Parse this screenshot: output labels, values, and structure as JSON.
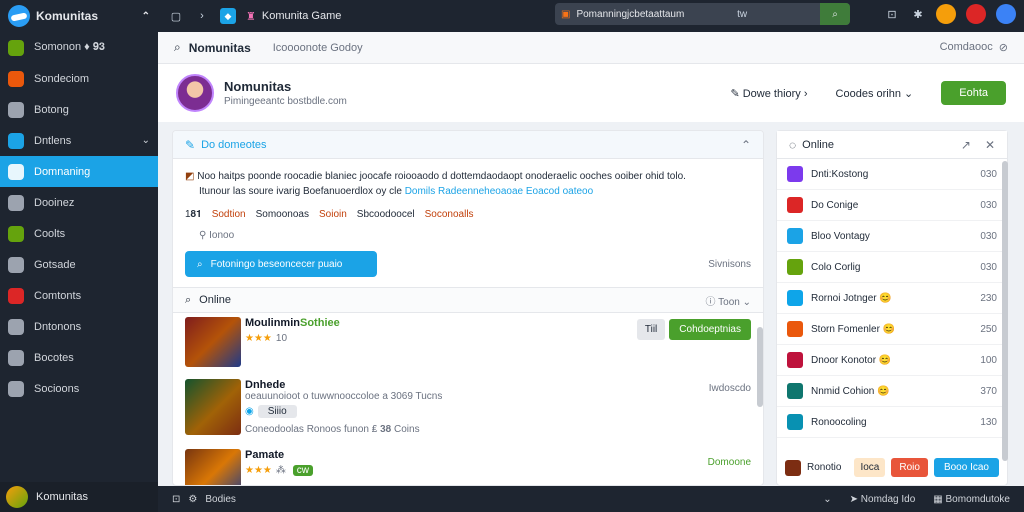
{
  "app": {
    "title": "Komunitas",
    "window_title": "Komunita Game"
  },
  "search": {
    "text": "Pomanningjcbetaattaum",
    "shortcut": "tw"
  },
  "sidebar": {
    "items": [
      {
        "label": "Somonon ♦ 𝟗𝟑",
        "icon": "community-icon"
      },
      {
        "label": "Sondeciom",
        "icon": "orb-icon"
      },
      {
        "label": "Botong",
        "icon": "person-icon"
      },
      {
        "label": "Dntlens",
        "icon": "game-icon",
        "tail": "⌄"
      },
      {
        "label": "Domnaning",
        "icon": "chat-icon",
        "active": true
      },
      {
        "label": "Dooinez",
        "icon": "folder-icon"
      },
      {
        "label": "Coolts",
        "icon": "map-icon"
      },
      {
        "label": "Gotsade",
        "icon": "heart-icon"
      },
      {
        "label": "Comtonts",
        "icon": "grid-icon"
      },
      {
        "label": "Dntonons",
        "icon": "briefcase-icon"
      },
      {
        "label": "Bocotes",
        "icon": "box-icon"
      },
      {
        "label": "Socioons",
        "icon": "list-icon"
      }
    ],
    "footer": "Komunitas"
  },
  "subbar": {
    "title": "Nomunitas",
    "crumb": "Icoooonote Godoy",
    "right": "Comdaooc"
  },
  "profile": {
    "name": "Nomunitas",
    "subtitle": "Pimingeeantc bostbdle.com",
    "action1": "Dowe thiory",
    "action2": "Coodes orihn",
    "button": "Eohta"
  },
  "feed": {
    "header": "Do domeotes",
    "post_text": "Noo haitps poonde roocadie blaniec joocafe roiooaodo d dottemdaodaopt onoderaelic ooches ooiber ohid tolo.",
    "post_text2": "Itunour las soure ivarig Boefanuoerdlox oy cle",
    "post_highlight": "Domils Radeenneheoaoae Eoacod oateoo",
    "tags": [
      "1𝟖𝟏",
      "Sodtion",
      "Somoonoas",
      "Soioin",
      "Sbcoodoocel",
      "Soconoalls"
    ],
    "meta": "Ionoo",
    "button": "Fotoningo beseoncecer puaio",
    "button_right": "Sivnisons",
    "section": "Online",
    "section_right": "Toon",
    "rows": [
      {
        "title": "Moulinmin",
        "title_hl": "Sothiee",
        "rating": "★★★",
        "count": "10",
        "btn1": "Tiil",
        "btn2": "Cohdoeptnias"
      },
      {
        "title": "Dnhede",
        "desc": "oeauunoioot o tuwwnooccoloe a 3069 Tucns",
        "right": "Iwdoscdo",
        "pill": "Siiio",
        "foot": "Coneodoolas Ronoos funon ₤ 𝟑𝟖 Coins"
      },
      {
        "title": "Pamate",
        "rating": "★★★",
        "count": "⁂",
        "pill": "cw",
        "right": "Domoone"
      }
    ]
  },
  "online": {
    "header": "Online",
    "items": [
      {
        "name": "Dnti:Kostong",
        "time": "030",
        "color": "#7c3aed"
      },
      {
        "name": "Do Conige",
        "time": "030",
        "color": "#dc2626"
      },
      {
        "name": "Bloo Vontagy",
        "time": "030",
        "color": "#1ba3e6"
      },
      {
        "name": "Colo Corlig",
        "time": "030",
        "color": "#65a30d"
      },
      {
        "name": "Rornoi Jotnger 😊",
        "time": "230",
        "color": "#0ea5e9"
      },
      {
        "name": "Storn Fomenler 😊",
        "time": "250",
        "color": "#ea580c"
      },
      {
        "name": "Dnoor Konotor 😊",
        "time": "100",
        "color": "#be123c"
      },
      {
        "name": "Nnmid Cohion 😊",
        "time": "370",
        "color": "#0f766e"
      },
      {
        "name": "Ronoocoling",
        "time": "130",
        "color": "#0891b2"
      }
    ],
    "foot_label": "Ronotio",
    "b1": "Ioca",
    "b2": "Roio",
    "b3": "Booo Icao"
  },
  "status": {
    "left": "Bodies",
    "mid": "Nomdag Ido",
    "right": "Bomomdutoke"
  },
  "colors": {
    "accent": "#1ba3e6",
    "green": "#4aa02c",
    "dark": "#1e2530"
  }
}
